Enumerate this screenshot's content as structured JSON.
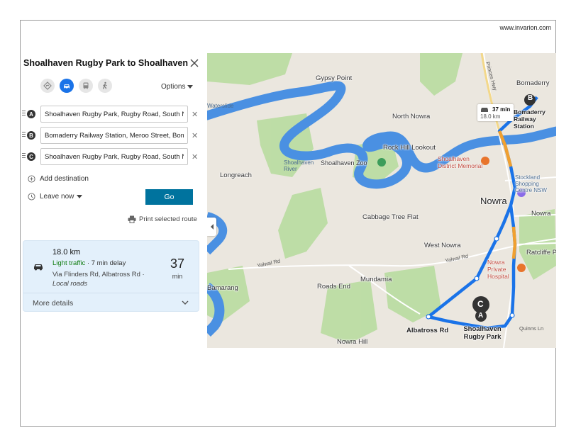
{
  "site_url": "www.invarion.com",
  "panel": {
    "title": "Shoalhaven Rugby Park to Shoalhaven ...",
    "options_label": "Options",
    "modes": [
      "directions-icon",
      "car-icon",
      "transit-icon",
      "walk-icon"
    ],
    "active_mode": "car-icon",
    "waypoints": [
      {
        "badge": "A",
        "value": "Shoalhaven Rugby Park, Rugby Road, South Nowra"
      },
      {
        "badge": "B",
        "value": "Bomaderry Railway Station, Meroo Street, Bomaderry"
      },
      {
        "badge": "C",
        "value": "Shoalhaven Rugby Park, Rugby Road, South Nowra"
      }
    ],
    "add_destination": "Add destination",
    "leave_now": "Leave now",
    "go_label": "Go",
    "print_label": "Print selected route",
    "route": {
      "distance": "18.0 km",
      "traffic": "Light traffic",
      "delay": " · 7 min delay",
      "via": "Via Flinders Rd, Albatross Rd · ",
      "via_note": "Local roads",
      "time": "37",
      "time_unit": "min",
      "more_details": "More details"
    }
  },
  "map": {
    "eta_time": "37 min",
    "eta_dist": "18.0 km",
    "colors": {
      "water": "#4a90e2",
      "route": "#1a73e8",
      "route_slow": "#f0a030",
      "land": "#ebe7df",
      "park": "#b9dca0"
    },
    "labels": {
      "gypsy_point": "Gypsy Point",
      "bomaderry": "Bomaderry",
      "bomaderry_station": "Bomaderry Railway Station",
      "north_nowra": "North Nowra",
      "waterslide": "Waterslide",
      "rock_hill": "Rock Hill Lookout",
      "district_memorial": "Shoalhaven District Memorial",
      "shoalhaven_river": "Shoalhaven River",
      "shoalhaven_zoo": "Shoalhaven Zoo",
      "longreach": "Longreach",
      "stockland": "Stockland Shopping Centre NSW",
      "nowra_big": "Nowra",
      "nowra_small": "Nowra",
      "cabbage_tree": "Cabbage Tree Flat",
      "west_nowra": "West Nowra",
      "ratcliffe": "Ratcliffe Park",
      "nowra_private": "Nowra Private Hospital",
      "mundamia": "Mundamia",
      "roads_end": "Roads End",
      "bamarang": "Bamarang",
      "albatross": "Albatross Rd",
      "rugby_park": "Shoalhaven Rugby Park",
      "nowra_hill": "Nowra Hill",
      "yalwal1": "Yalwal Rd",
      "yalwal2": "Yalwal Rd",
      "princes": "Princes Hwy",
      "quinns": "Quinns Ln",
      "marker_a": "A",
      "marker_b": "B",
      "marker_c": "C"
    }
  }
}
